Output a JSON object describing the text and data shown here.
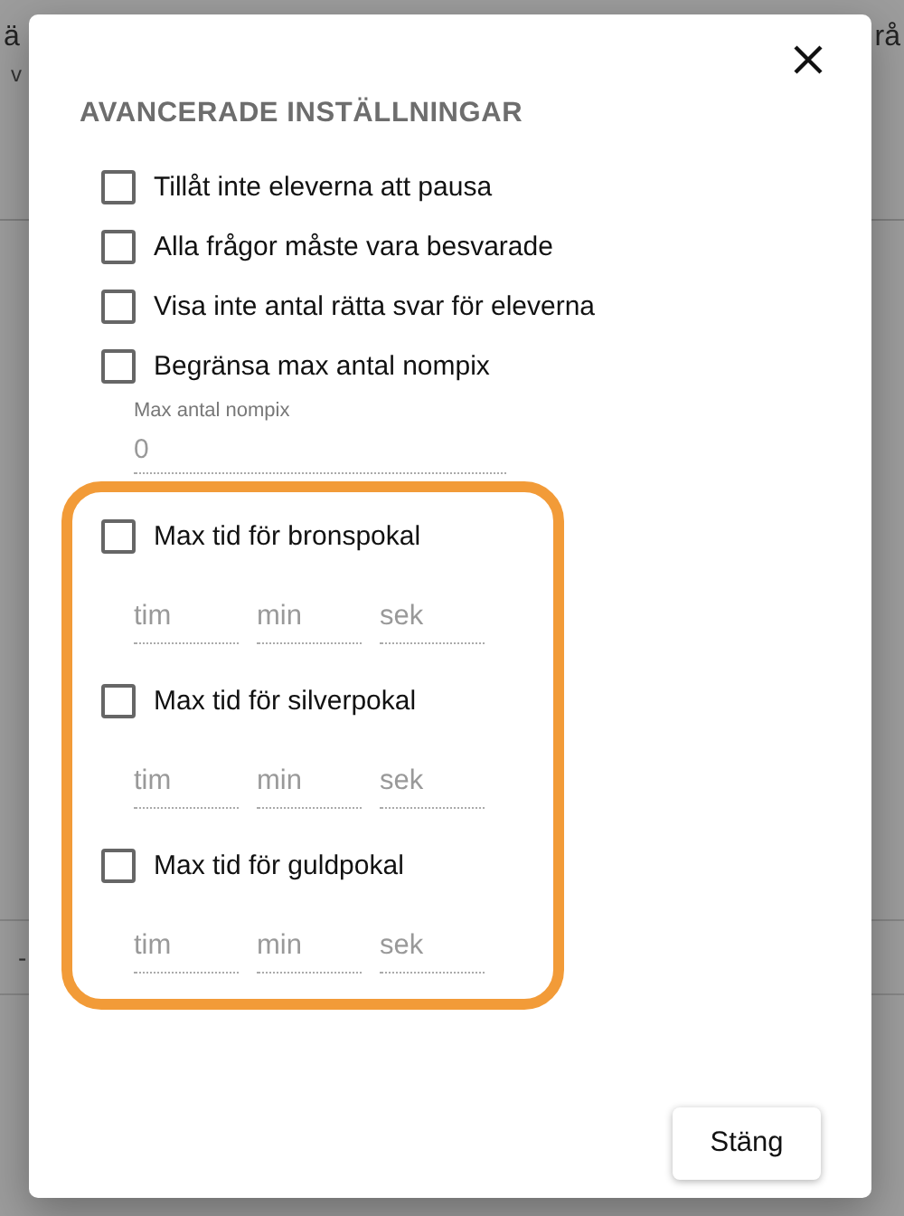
{
  "background": {
    "texts": [
      "ä",
      "v",
      "rå",
      "-"
    ]
  },
  "dialog": {
    "title": "AVANCERADE INSTÄLLNINGAR",
    "options": [
      {
        "label": "Tillåt inte eleverna att pausa",
        "checked": false
      },
      {
        "label": "Alla frågor måste vara besvarade",
        "checked": false
      },
      {
        "label": "Visa inte antal rätta svar för eleverna",
        "checked": false
      },
      {
        "label": "Begränsa max antal nompix",
        "checked": false
      }
    ],
    "limit_field": {
      "label": "Max antal nompix",
      "placeholder": "0"
    },
    "trophy_times": [
      {
        "label": "Max tid för bronspokal",
        "checked": false,
        "fields": [
          {
            "placeholder": "tim"
          },
          {
            "placeholder": "min"
          },
          {
            "placeholder": "sek"
          }
        ]
      },
      {
        "label": "Max tid för silverpokal",
        "checked": false,
        "fields": [
          {
            "placeholder": "tim"
          },
          {
            "placeholder": "min"
          },
          {
            "placeholder": "sek"
          }
        ]
      },
      {
        "label": "Max tid för guldpokal",
        "checked": false,
        "fields": [
          {
            "placeholder": "tim"
          },
          {
            "placeholder": "min"
          },
          {
            "placeholder": "sek"
          }
        ]
      }
    ],
    "buttons": [
      "Stäng"
    ]
  }
}
